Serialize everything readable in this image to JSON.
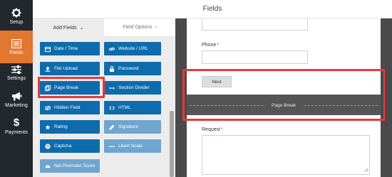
{
  "app": {
    "title": "Fields"
  },
  "nav": {
    "items": [
      {
        "label": "Setup",
        "icon": "gear-icon"
      },
      {
        "label": "Fields",
        "icon": "fields-list-icon",
        "active": true
      },
      {
        "label": "Settings",
        "icon": "sliders-icon"
      },
      {
        "label": "Marketing",
        "icon": "megaphone-icon"
      },
      {
        "label": "Payments",
        "icon": "dollar-icon"
      }
    ]
  },
  "panel": {
    "tabs": [
      {
        "label": "Add Fields",
        "chevron": "⌄",
        "active": true
      },
      {
        "label": "Field Options",
        "chevron": "›",
        "active": false
      }
    ],
    "fields": [
      {
        "label": "Date / Time",
        "icon": "calendar-icon"
      },
      {
        "label": "Website / URL",
        "icon": "link-icon"
      },
      {
        "label": "File Upload",
        "icon": "upload-icon"
      },
      {
        "label": "Password",
        "icon": "lock-icon"
      },
      {
        "label": "Page Break",
        "icon": "copy-icon"
      },
      {
        "label": "Section Divider",
        "icon": "arrows-h-icon"
      },
      {
        "label": "Hidden Field",
        "icon": "eye-slash-icon"
      },
      {
        "label": "HTML",
        "icon": "code-icon"
      },
      {
        "label": "Rating",
        "icon": "star-icon"
      },
      {
        "label": "Signature",
        "icon": "pen-icon"
      },
      {
        "label": "Captcha",
        "icon": "question-icon"
      },
      {
        "label": "Likert Scale",
        "icon": "ellipsis-icon"
      },
      {
        "label": "Net Promoter Score",
        "icon": "gauge-icon"
      }
    ]
  },
  "preview": {
    "phone_label": "Phone",
    "required_mark": "*",
    "next_label": "Next",
    "page_break_label": "Page Break",
    "request_label": "Request"
  },
  "colors": {
    "nav_bg": "#23282d",
    "nav_active": "#e27730",
    "field_button": "#0e6cad",
    "highlight": "#e8393d",
    "preview_bg": "#4a4a4a"
  }
}
